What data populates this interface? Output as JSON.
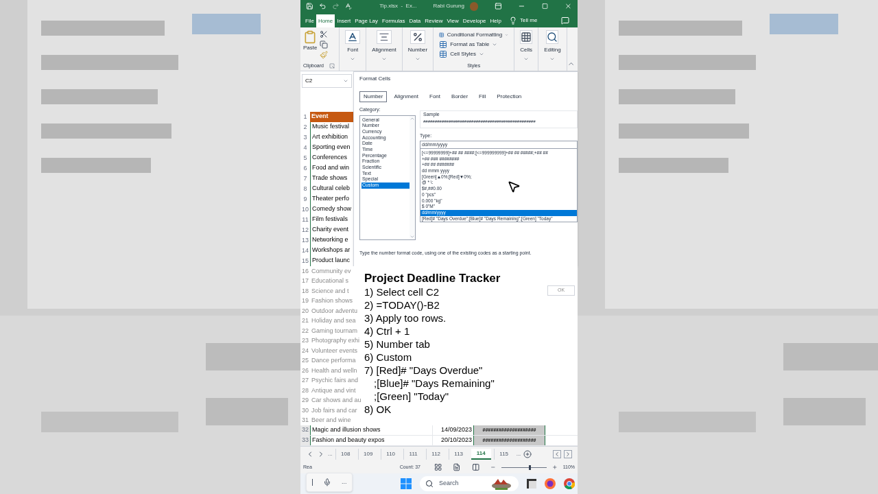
{
  "title_bar": {
    "file": "Tip.xlsx  -  Ex...",
    "user": "Rabi Gurung"
  },
  "ribbon_tabs": [
    {
      "label": "File",
      "selected": false
    },
    {
      "label": "Home",
      "selected": true
    },
    {
      "label": "Insert",
      "selected": false
    },
    {
      "label": "Page Lay",
      "selected": false
    },
    {
      "label": "Formulas",
      "selected": false
    },
    {
      "label": "Data",
      "selected": false
    },
    {
      "label": "Review",
      "selected": false
    },
    {
      "label": "View",
      "selected": false
    },
    {
      "label": "Develope",
      "selected": false
    },
    {
      "label": "Help",
      "selected": false
    }
  ],
  "tell_me": "Tell me",
  "ribbon": {
    "paste": "Paste",
    "clipboard": "Clipboard",
    "buttons": [
      {
        "label": "Font",
        "kind": "font"
      },
      {
        "label": "Alignment",
        "kind": "alignment"
      },
      {
        "label": "Number",
        "kind": "number"
      }
    ],
    "styles": [
      "Conditional Formatting",
      "Format as Table",
      "Cell Styles"
    ],
    "styles_label": "Styles",
    "right_buttons": [
      {
        "label": "Cells",
        "kind": "cells"
      },
      {
        "label": "Editing",
        "kind": "editing"
      }
    ]
  },
  "name_box": "C2",
  "top_rows": [
    {
      "n": "1",
      "text": "Event",
      "kind": "header"
    },
    {
      "n": "2",
      "text": "Music festival",
      "kind": "row"
    },
    {
      "n": "3",
      "text": "Art exhibition",
      "kind": "row"
    },
    {
      "n": "4",
      "text": "Sporting even",
      "kind": "row"
    },
    {
      "n": "5",
      "text": "Conferences",
      "kind": "row"
    },
    {
      "n": "6",
      "text": "Food and win",
      "kind": "row"
    },
    {
      "n": "7",
      "text": "Trade shows",
      "kind": "row"
    },
    {
      "n": "8",
      "text": "Cultural celeb",
      "kind": "row"
    },
    {
      "n": "9",
      "text": "Theater perfo",
      "kind": "row"
    },
    {
      "n": "10",
      "text": "Comedy show",
      "kind": "row"
    },
    {
      "n": "11",
      "text": "Film festivals",
      "kind": "row"
    },
    {
      "n": "12",
      "text": "Charity event",
      "kind": "row"
    },
    {
      "n": "13",
      "text": "Networking e",
      "kind": "row"
    },
    {
      "n": "14",
      "text": "Workshops ar",
      "kind": "row"
    },
    {
      "n": "15",
      "text": "Product launc",
      "kind": "row"
    }
  ],
  "dialog": {
    "title": "Format Cells",
    "tabs": [
      {
        "label": "Number",
        "selected": true
      },
      {
        "label": "Alignment",
        "selected": false
      },
      {
        "label": "Font",
        "selected": false
      },
      {
        "label": "Border",
        "selected": false
      },
      {
        "label": "Fill",
        "selected": false
      },
      {
        "label": "Protection",
        "selected": false
      }
    ],
    "category_label": "Category:",
    "categories": [
      {
        "label": "General",
        "selected": false
      },
      {
        "label": "Number",
        "selected": false
      },
      {
        "label": "Currency",
        "selected": false
      },
      {
        "label": "Accounting",
        "selected": false
      },
      {
        "label": "Date",
        "selected": false
      },
      {
        "label": "Time",
        "selected": false
      },
      {
        "label": "Percentage",
        "selected": false
      },
      {
        "label": "Fraction",
        "selected": false
      },
      {
        "label": "Scientific",
        "selected": false
      },
      {
        "label": "Text",
        "selected": false
      },
      {
        "label": "Special",
        "selected": false
      },
      {
        "label": "Custom",
        "selected": true
      }
    ],
    "sample_label": "Sample",
    "sample": "#################################################",
    "type_label": "Type:",
    "type_value": "dd/mm/yyyy",
    "codes": [
      {
        "label": "[<=99999999]+## ## ####;[<=999999999]+## ## #####;+## ##",
        "selected": false
      },
      {
        "label": "+## ### ########",
        "selected": false
      },
      {
        "label": "+## ## #######",
        "selected": false
      },
      {
        "label": "dd mmm yyyy",
        "selected": false
      },
      {
        "label": "[Green]▲0%;[Red]▼0%;",
        "selected": false
      },
      {
        "label": "@ * \\:",
        "selected": false
      },
      {
        "label": "$#,##0.00",
        "selected": false
      },
      {
        "label": "0 \"pcs\"",
        "selected": false
      },
      {
        "label": "0.000 \"kg\"",
        "selected": false
      },
      {
        "label": "$ 0\"M\"",
        "selected": false
      },
      {
        "label": "dd/mm/yyyy",
        "selected": true
      },
      {
        "label": "[Red]# \"Days Overdue\";[Blue]# \"Days Remaining\";[Green] \"Today\"",
        "selected": false
      }
    ],
    "hint": "Type the number format code, using one of the existing codes as a starting point.",
    "ok": {
      "label": "OK",
      "disabled": true
    }
  },
  "faded_rows": [
    {
      "n": "16",
      "text": "Community ev"
    },
    {
      "n": "17",
      "text": "Educational s"
    },
    {
      "n": "18",
      "text": "Science and t"
    },
    {
      "n": "19",
      "text": "Fashion shows"
    },
    {
      "n": "20",
      "text": "Outdoor adventu"
    },
    {
      "n": "21",
      "text": "Holiday and sea"
    },
    {
      "n": "22",
      "text": "Gaming tournam"
    },
    {
      "n": "23",
      "text": "Photography exhi"
    },
    {
      "n": "24",
      "text": "Volunteer events"
    },
    {
      "n": "25",
      "text": "Dance performa"
    },
    {
      "n": "26",
      "text": "Health and welln"
    },
    {
      "n": "27",
      "text": "Psychic fairs and"
    },
    {
      "n": "28",
      "text": "Antique and vint"
    },
    {
      "n": "29",
      "text": "Car shows and au"
    },
    {
      "n": "30",
      "text": "Job fairs and car"
    },
    {
      "n": "31",
      "text": "Beer and wine"
    }
  ],
  "caption": {
    "title": "Project Deadline Tracker",
    "lines": [
      {
        "text": "1) Select cell C2",
        "kind": "step"
      },
      {
        "text": "2) =TODAY()-B2",
        "kind": "step"
      },
      {
        "text": "3) Apply too rows.",
        "kind": "step"
      },
      {
        "text": "4) Ctrl + 1",
        "kind": "step"
      },
      {
        "text": "5) Number tab",
        "kind": "step"
      },
      {
        "text": "6) Custom",
        "kind": "step"
      },
      {
        "text": "7) [Red]# \"Days Overdue\"",
        "kind": "step"
      },
      {
        "text": ";[Blue]# \"Days Remaining\"",
        "kind": "continuation"
      },
      {
        "text": ";[Green] \"Today\"",
        "kind": "continuation"
      },
      {
        "text": "8) OK",
        "kind": "step"
      }
    ]
  },
  "bottom_rows": [
    {
      "n": "32",
      "name": "Magic and illusion shows",
      "date": "14/09/2023",
      "value": "####################"
    },
    {
      "n": "33",
      "name": "Fashion and beauty expos",
      "date": "20/10/2023",
      "value": "####################"
    }
  ],
  "sheet_tabs": [
    {
      "label": "108",
      "selected": false
    },
    {
      "label": "109",
      "selected": false
    },
    {
      "label": "110",
      "selected": false
    },
    {
      "label": "111",
      "selected": false
    },
    {
      "label": "112",
      "selected": false
    },
    {
      "label": "113",
      "selected": false
    },
    {
      "label": "114",
      "selected": true
    },
    {
      "label": "115",
      "selected": false
    }
  ],
  "tabs_more": "...",
  "status_bar": {
    "ready": "Rea",
    "count": "Count: 37",
    "zoom": "110%",
    "zoom_slider": {
      "level": 0.6
    }
  },
  "voice_more": "...",
  "taskbar": {
    "search": "Search"
  }
}
